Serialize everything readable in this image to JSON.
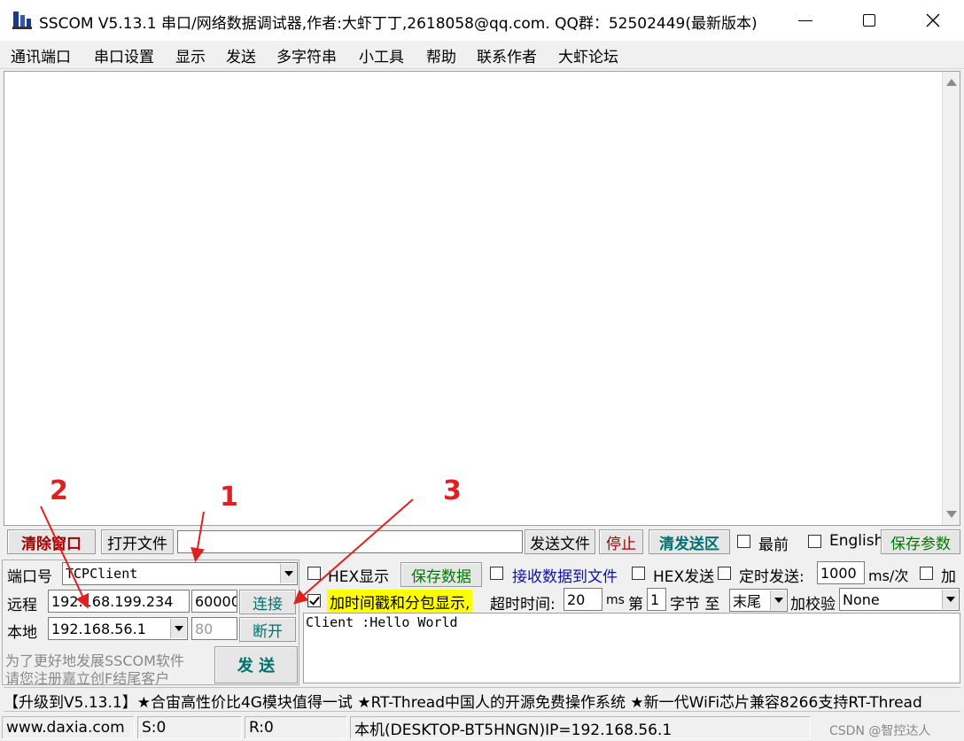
{
  "window": {
    "title": "SSCOM V5.13.1 串口/网络数据调试器,作者:大虾丁丁,2618058@qq.com. QQ群：52502449(最新版本)",
    "icons": {
      "app": "sscom-app-icon",
      "minimize": "minimize-icon",
      "maximize": "maximize-icon",
      "close": "close-icon"
    }
  },
  "menu": [
    "通讯端口",
    "串口设置",
    "显示",
    "发送",
    "多字符串",
    "小工具",
    "帮助",
    "联系作者",
    "大虾论坛"
  ],
  "toolbar": {
    "clear_window": "清除窗口",
    "open_file": "打开文件",
    "send_file": "发送文件",
    "stop": "停止",
    "clear_send_area": "清发送区",
    "latest_label": "最前",
    "english_label": "English",
    "save_params": "保存参数"
  },
  "connection": {
    "port_label": "端口号",
    "port_value": "TCPClient",
    "remote_label": "远程",
    "remote_ip": "192.168.199.234",
    "remote_port": "60000",
    "connect_button": "连接",
    "local_label": "本地",
    "local_ip": "192.168.56.1",
    "local_port": "80",
    "disconnect_button": "断开",
    "promo_line1": "为了更好地发展SSCOM软件",
    "promo_line2": "请您注册嘉立创F结尾客户",
    "send_button": "发 送"
  },
  "options": {
    "hex_display": "HEX显示",
    "save_data": "保存数据",
    "recv_to_file": "接收数据到文件",
    "hex_send": "HEX发送",
    "timed_send": "定时发送:",
    "interval_value": "1000",
    "interval_unit": "ms/次",
    "add_label": "加",
    "timestamp_label": "加时间戳和分包显示,",
    "timeout_label": "超时时间:",
    "timeout_value": "20",
    "timeout_unit": "ms",
    "byte_prefix": "第",
    "byte_index": "1",
    "byte_suffix": "字节 至",
    "end_value": "末尾",
    "checksum_label": "加校验",
    "checksum_value": "None"
  },
  "send_area_text": "Client :Hello World",
  "marquee": "【升级到V5.13.1】★合宙高性价比4G模块值得一试 ★RT-Thread中国人的开源免费操作系统 ★新一代WiFi芯片兼容8266支持RT-Thread",
  "status": {
    "website": "www.daxia.com",
    "sent": "S:0",
    "received": "R:0",
    "host_info": "本机(DESKTOP-BT5HNGN)IP=192.168.56.1"
  },
  "annotations": [
    "1",
    "2",
    "3"
  ],
  "watermark": "CSDN @智控达人",
  "colors": {
    "annotation": "#e02020",
    "highlight": "#ffff00",
    "dark_red": "#a00000",
    "teal": "#007070",
    "green": "#007a00",
    "blue": "#1010c0"
  }
}
